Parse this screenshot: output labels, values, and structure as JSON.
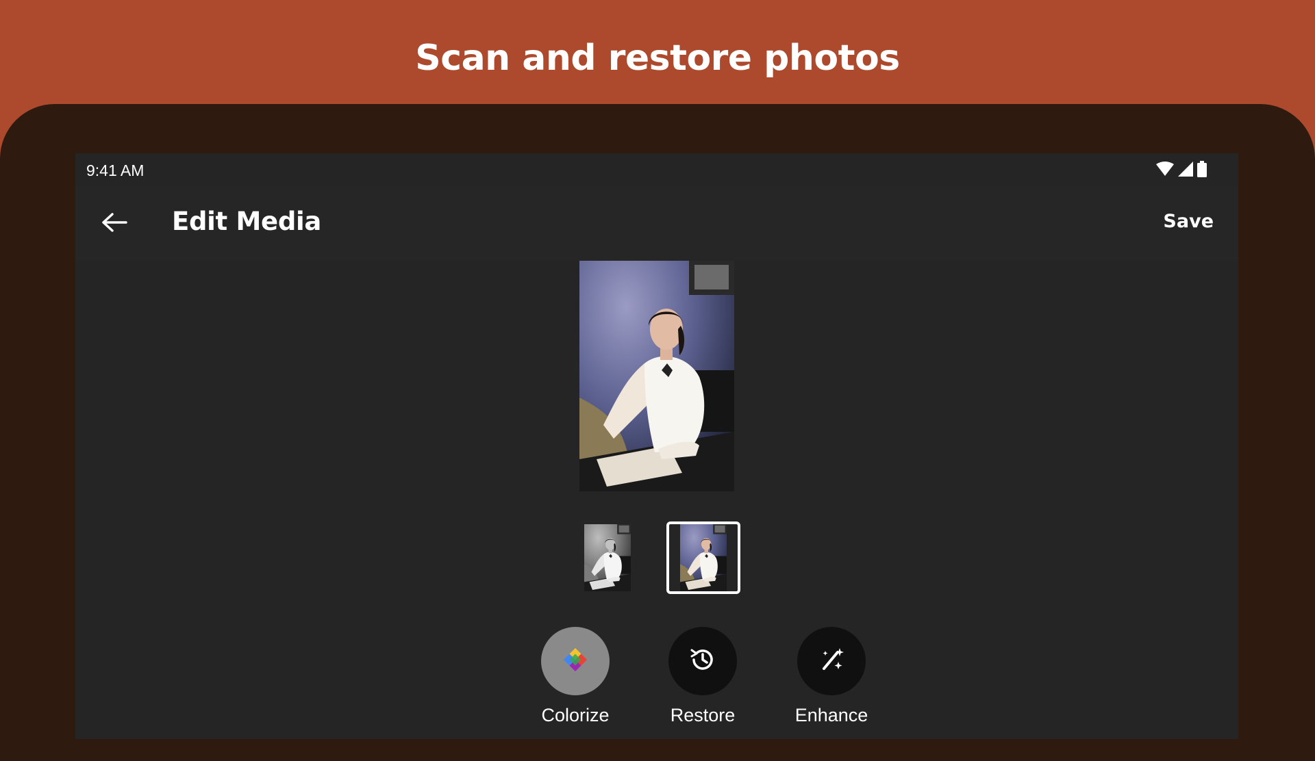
{
  "banner": {
    "title": "Scan and restore photos"
  },
  "status_bar": {
    "time": "9:41 AM",
    "icons": [
      "wifi-icon",
      "signal-icon",
      "battery-icon"
    ]
  },
  "toolbar": {
    "back_icon": "arrow-left-icon",
    "title": "Edit Media",
    "save_label": "Save"
  },
  "thumbnails": [
    {
      "variant": "original (black & white)",
      "selected": false
    },
    {
      "variant": "colorized",
      "selected": true
    }
  ],
  "tools": [
    {
      "label": "Colorize",
      "icon": "color-wheel-icon",
      "active": true
    },
    {
      "label": "Restore",
      "icon": "history-icon",
      "active": false
    },
    {
      "label": "Enhance",
      "icon": "magic-wand-icon",
      "active": false
    }
  ],
  "colors": {
    "banner_bg": "#ad4a2d",
    "device_frame": "#2f1a10",
    "screen_bg": "#252525",
    "active_tool_bg": "#8a8a8a",
    "inactive_tool_bg": "#101010"
  }
}
